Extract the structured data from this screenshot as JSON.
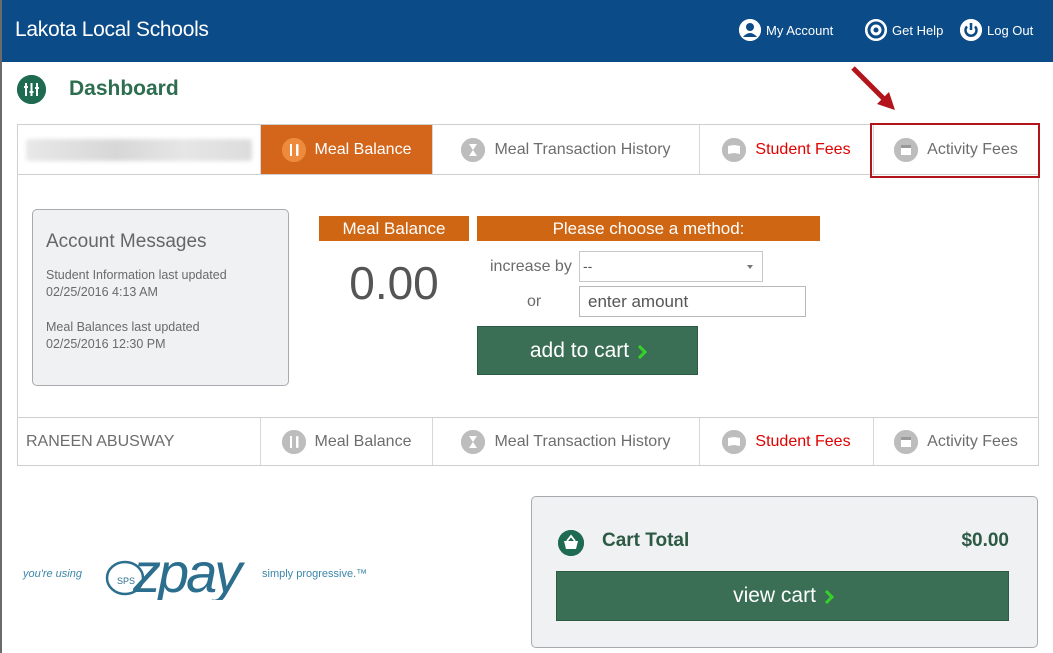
{
  "header": {
    "brand": "Lakota Local Schools",
    "my_account": "My Account",
    "get_help": "Get Help",
    "log_out": "Log Out",
    "background": "#0b4b87"
  },
  "page": {
    "title": "Dashboard"
  },
  "students": [
    {
      "name": "",
      "name_redacted": true,
      "tabs": {
        "meal_balance": "Meal Balance",
        "meal_history": "Meal Transaction History",
        "student_fees": "Student Fees",
        "activity_fees": "Activity Fees"
      },
      "active_tab": "meal_balance"
    },
    {
      "name": "RANEEN ABUSWAY",
      "tabs": {
        "meal_balance": "Meal Balance",
        "meal_history": "Meal Transaction History",
        "student_fees": "Student Fees",
        "activity_fees": "Activity Fees"
      }
    }
  ],
  "account_messages": {
    "title": "Account Messages",
    "student_info_label": "Student Information last updated",
    "student_info_date": "02/25/2016 4:13 AM",
    "meal_label": "Meal Balances last updated",
    "meal_date": "02/25/2016 12:30 PM"
  },
  "meal_balance": {
    "label": "Meal Balance",
    "value": "0.00"
  },
  "payment": {
    "method_label": "Please choose a method:",
    "increase_label": "increase by",
    "increase_selected": "--",
    "or_label": "or",
    "amount_placeholder": "enter amount",
    "add_to_cart": "add to cart"
  },
  "logo": {
    "prefix": "you're using",
    "brand": "ezpay",
    "sub": "SPS",
    "tagline": "simply progressive.™"
  },
  "cart": {
    "title": "Cart Total",
    "total": "$0.00",
    "view_cart": "view cart"
  },
  "colors": {
    "accent_orange": "#cf6613",
    "accent_green": "#3a6e55",
    "fees_red": "#e00000",
    "highlight_red": "#b3141c"
  }
}
